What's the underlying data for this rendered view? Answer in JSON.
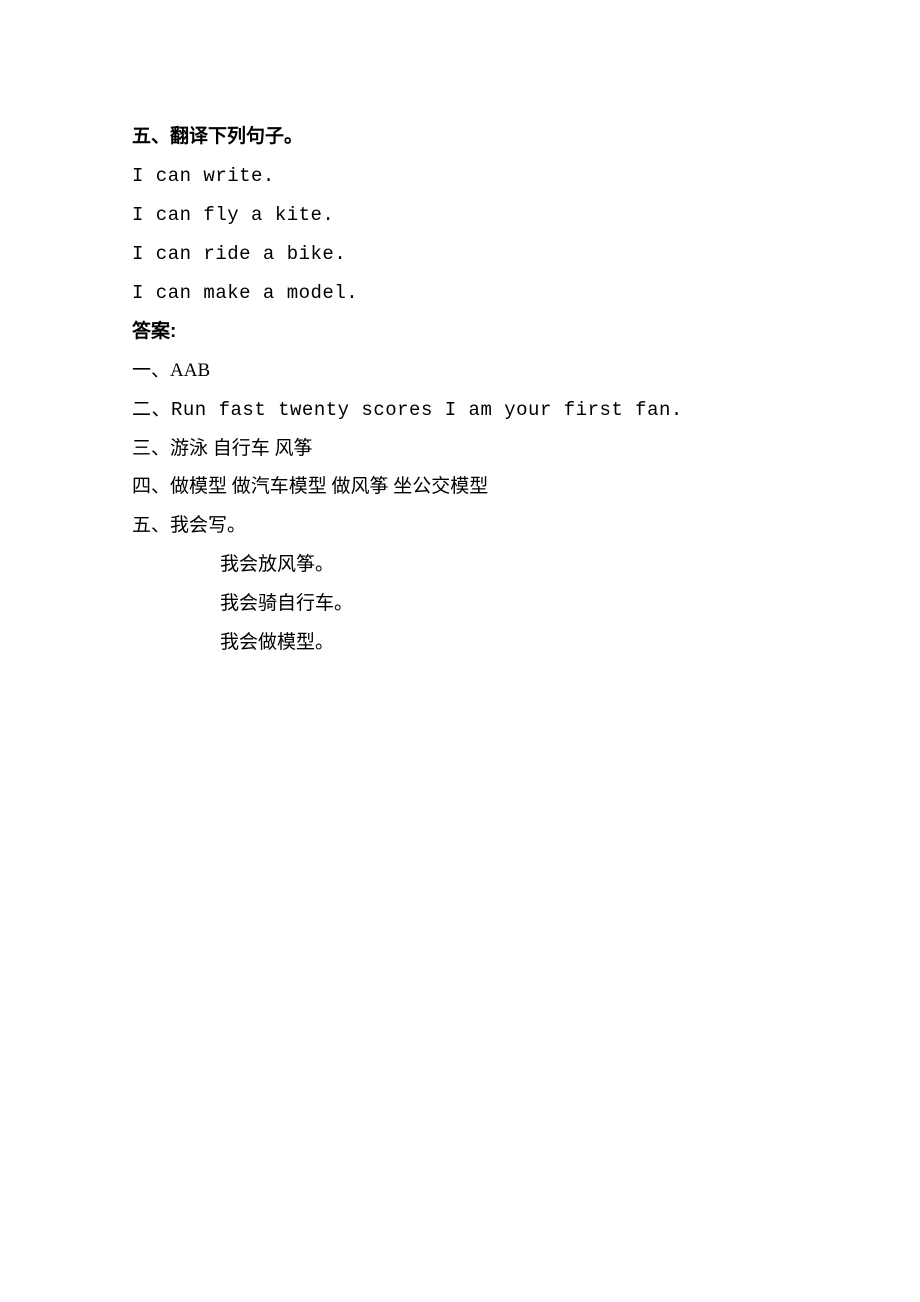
{
  "section5": {
    "heading": "五、翻译下列句子。",
    "lines": [
      "I can write.",
      "I can fly a kite.",
      "I can ride a bike.",
      "I can make a model."
    ]
  },
  "answers": {
    "heading": "答案:",
    "items": [
      "一、AAB",
      "二、Run fast twenty scores I am your first fan.",
      "三、游泳 自行车 风筝",
      "四、做模型 做汽车模型 做风筝 坐公交模型",
      "五、我会写。"
    ],
    "continued": [
      "我会放风筝。",
      "我会骑自行车。",
      "我会做模型。"
    ]
  }
}
